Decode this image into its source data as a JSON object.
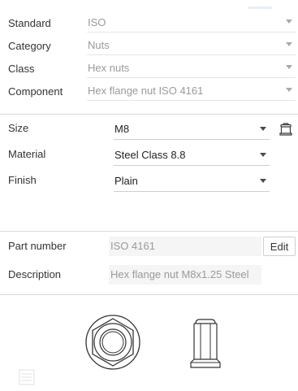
{
  "top": {
    "rows": [
      {
        "label": "Standard",
        "value": "ISO"
      },
      {
        "label": "Category",
        "value": "Nuts"
      },
      {
        "label": "Class",
        "value": "Hex nuts"
      },
      {
        "label": "Component",
        "value": "Hex flange nut ISO 4161"
      }
    ]
  },
  "spec": {
    "rows": [
      {
        "label": "Size",
        "value": "M8"
      },
      {
        "label": "Material",
        "value": "Steel Class 8.8"
      },
      {
        "label": "Finish",
        "value": "Plain"
      }
    ],
    "size_icon": "hex-nut-side-icon"
  },
  "part": {
    "part_number_label": "Part number",
    "part_number_value": "ISO 4161",
    "edit_label": "Edit",
    "description_label": "Description",
    "description_value": "Hex flange nut M8x1.25 Steel"
  },
  "preview": {
    "front_icon": "hex-flange-nut-front-view",
    "side_icon": "hex-flange-nut-side-view"
  },
  "colors": {
    "muted_text": "#9a9a9a",
    "divider": "#d9d9d9",
    "readonly_bg": "#f5f5f5"
  }
}
